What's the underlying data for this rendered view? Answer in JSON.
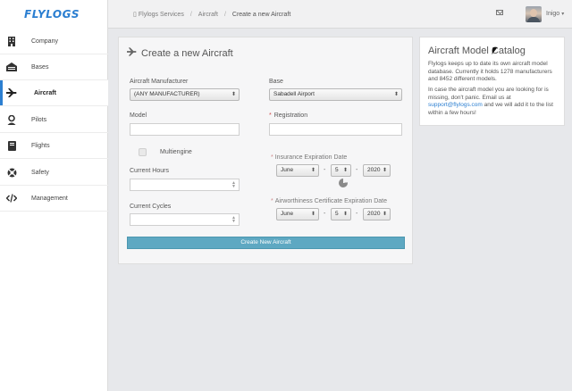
{
  "app": {
    "logo": "FLYLOGS"
  },
  "sidebar": {
    "items": [
      {
        "label": "Company",
        "icon": "building-icon"
      },
      {
        "label": "Bases",
        "icon": "hangar-icon"
      },
      {
        "label": "Aircraft",
        "icon": "plane-icon",
        "active": true
      },
      {
        "label": "Pilots",
        "icon": "pilot-icon"
      },
      {
        "label": "Flights",
        "icon": "logbook-icon"
      },
      {
        "label": "Safety",
        "icon": "lifebuoy-icon"
      },
      {
        "label": "Management",
        "icon": "code-icon"
      }
    ]
  },
  "header": {
    "breadcrumbs": [
      "Flylogs Services",
      "Aircraft",
      "Create a new Aircraft"
    ],
    "user_name": "Inigo"
  },
  "form": {
    "title": "Create a new Aircraft",
    "manufacturer_label": "Aircraft Manufacturer",
    "manufacturer_value": "(ANY MANUFACTURER)",
    "base_label": "Base",
    "base_value": "Sabadell Airport",
    "model_label": "Model",
    "model_value": "",
    "registration_label": "Registration",
    "registration_value": "",
    "multiengine_label": "Multiengine",
    "multiengine_checked": false,
    "hours_label": "Current Hours",
    "hours_value": "",
    "cycles_label": "Current Cycles",
    "cycles_value": "",
    "insurance_label": "Insurance Expiration Date",
    "insurance_month": "June",
    "insurance_day": "5",
    "insurance_year": "2020",
    "airworthiness_label": "Airworthiness Certificate Expiration Date",
    "airworthiness_month": "June",
    "airworthiness_day": "5",
    "airworthiness_year": "2020",
    "date_separator": "-",
    "submit_label": "Create New Aircraft"
  },
  "catalog": {
    "title": "Aircraft Model Catalog",
    "paragraph1": "Flylogs keeps up to date its own aircraft model database. Currently it holds 1278 manufacturers and 8452 different models.",
    "paragraph2_before": "In case the aircraft model you are looking for is missing, don't panic. Email us at",
    "support_email": "support@flylogs.com",
    "paragraph2_after": "and we will add it to the list within a few hours!"
  },
  "colors": {
    "accent": "#2c7fd1",
    "primary_button": "#5ea8c2",
    "required": "#d04a4a"
  }
}
